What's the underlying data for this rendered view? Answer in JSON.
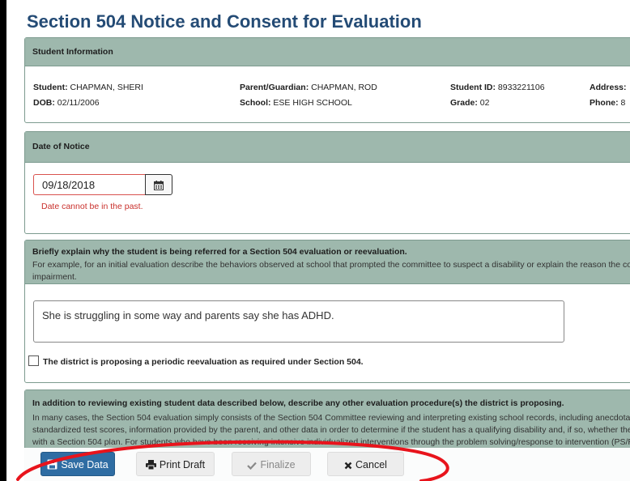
{
  "page": {
    "title": "Section 504 Notice and Consent for Evaluation"
  },
  "student_info": {
    "header": "Student Information",
    "fields": [
      {
        "label": "Student:",
        "value": "CHAPMAN, SHERI"
      },
      {
        "label": "Parent/Guardian:",
        "value": "CHAPMAN, ROD"
      },
      {
        "label": "Student ID:",
        "value": "8933221106"
      },
      {
        "label": "Address:",
        "value": ""
      },
      {
        "label": "DOB:",
        "value": "02/11/2006"
      },
      {
        "label": "School:",
        "value": "ESE HIGH SCHOOL"
      },
      {
        "label": "Grade:",
        "value": "02"
      },
      {
        "label": "Phone:",
        "value": "8"
      }
    ]
  },
  "notice_date": {
    "header": "Date of Notice",
    "value": "09/18/2018",
    "error": "Date cannot be in the past."
  },
  "referral": {
    "header": "Briefly explain why the student is being referred for a Section 504 evaluation or reevaluation.",
    "help": "For example, for an initial evaluation describe the behaviors observed at school that prompted the committee to suspect a disability or explain the reason the co impairment.",
    "text": "She is struggling in some way and parents say she has ADHD.",
    "checkbox_label": "The district is proposing a periodic reevaluation as required under Section 504.",
    "checkbox_checked": false
  },
  "procedures": {
    "header": "In addition to reviewing existing student data described below, describe any other evaluation procedure(s) the district is proposing.",
    "help": "In many cases, the Section 504 evaluation simply consists of the Section 504 Committee reviewing and interpreting existing school records, including anecdotal standardized test scores, information provided by the parent, and other data in order to determine if the student has a qualifying disability and, if so, whether the with a Section 504 plan. For students who have been receiving intensive individualized interventions through the problem solving/response to intervention (PS/R"
  },
  "actions": {
    "save": "Save Data",
    "print": "Print Draft",
    "finalize": "Finalize",
    "cancel": "Cancel"
  },
  "colors": {
    "title": "#244b75",
    "panel_header": "#9eb8ad",
    "error": "#c9302c",
    "primary_button": "#2f6da3",
    "annotation": "#e8141c"
  }
}
